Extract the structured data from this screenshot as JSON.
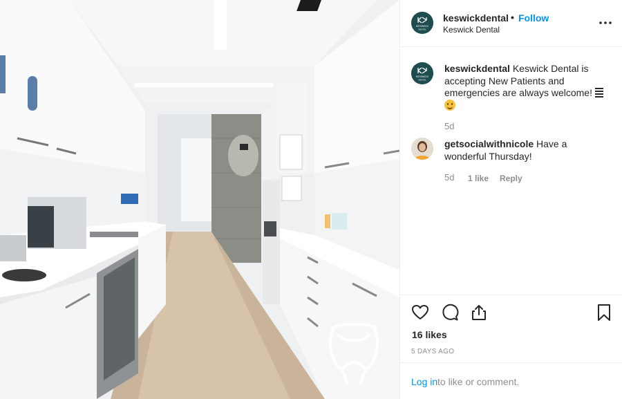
{
  "post": {
    "username": "keswickdental",
    "separator": "•",
    "follow_label": "Follow",
    "full_name": "Keswick Dental",
    "avatar_text_top": "KESWICK",
    "avatar_text_bottom": "DENTAL"
  },
  "caption": {
    "username": "keswickdental",
    "text": "Keswick Dental is accepting New Patients and emergencies are always welcome!",
    "emojis": [
      "news-text-emoji",
      "smiling-face-emoji"
    ],
    "age": "5d"
  },
  "comments": [
    {
      "username": "getsocialwithnicole",
      "text": "Have a wonderful Thursday!",
      "age": "5d",
      "likes": "1 like",
      "reply_label": "Reply"
    }
  ],
  "actions": {
    "icons": [
      "heart-icon",
      "comment-icon",
      "share-icon",
      "bookmark-icon"
    ]
  },
  "likes_label": "16 likes",
  "date_label": "5 DAYS AGO",
  "login": {
    "link_label": "Log in",
    "rest_text": "to like or comment."
  },
  "colors": {
    "link_blue": "#0095f6",
    "brand_teal": "#1f4d4f",
    "muted_gray": "#8e8e8e"
  }
}
